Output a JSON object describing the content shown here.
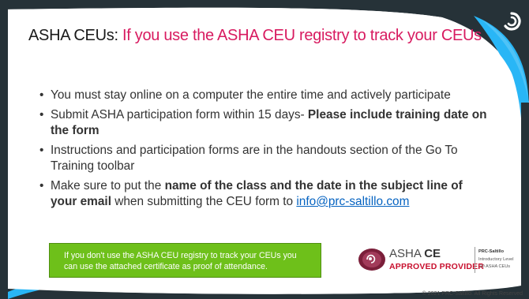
{
  "title": {
    "prefix": "ASHA CEUs: ",
    "highlight": "If you use the ASHA CEU registry to track your CEUs"
  },
  "bullets": [
    {
      "text": "You must stay online on a computer the entire time and actively participate"
    },
    {
      "text": "Submit ASHA participation form within 15 days- ",
      "bold": "Please include training date on the form"
    },
    {
      "text": "Instructions and participation forms are in the handouts section of the Go To Training toolbar"
    },
    {
      "pre": "Make sure to put the ",
      "bold": "name of the class and the date in the subject line of your email",
      "post": " when submitting the CEU form to ",
      "link": "info@prc-saltillo.com"
    }
  ],
  "note": "If you don't use the ASHA CEU registry to track your CEUs you can use the attached certificate as proof of attendance.",
  "asha_badge": {
    "word": "ASHA",
    "ce": "CE",
    "approved": "APPROVED PROVIDER",
    "provider": "PRC-Saltillo",
    "level": "Introductory Level",
    "ceus": ".10 ASHA CEUs"
  },
  "footer": "© 2021 PRC-Saltillo. All Rights Reserved",
  "colors": {
    "title_highlight": "#d81b60",
    "note_box": "#6ec01a",
    "frame": "#263238",
    "accent_swoosh": "#29b6f6"
  },
  "icons": {
    "corner": "prc-saltillo-logo",
    "badge": "asha-speech-logo"
  }
}
